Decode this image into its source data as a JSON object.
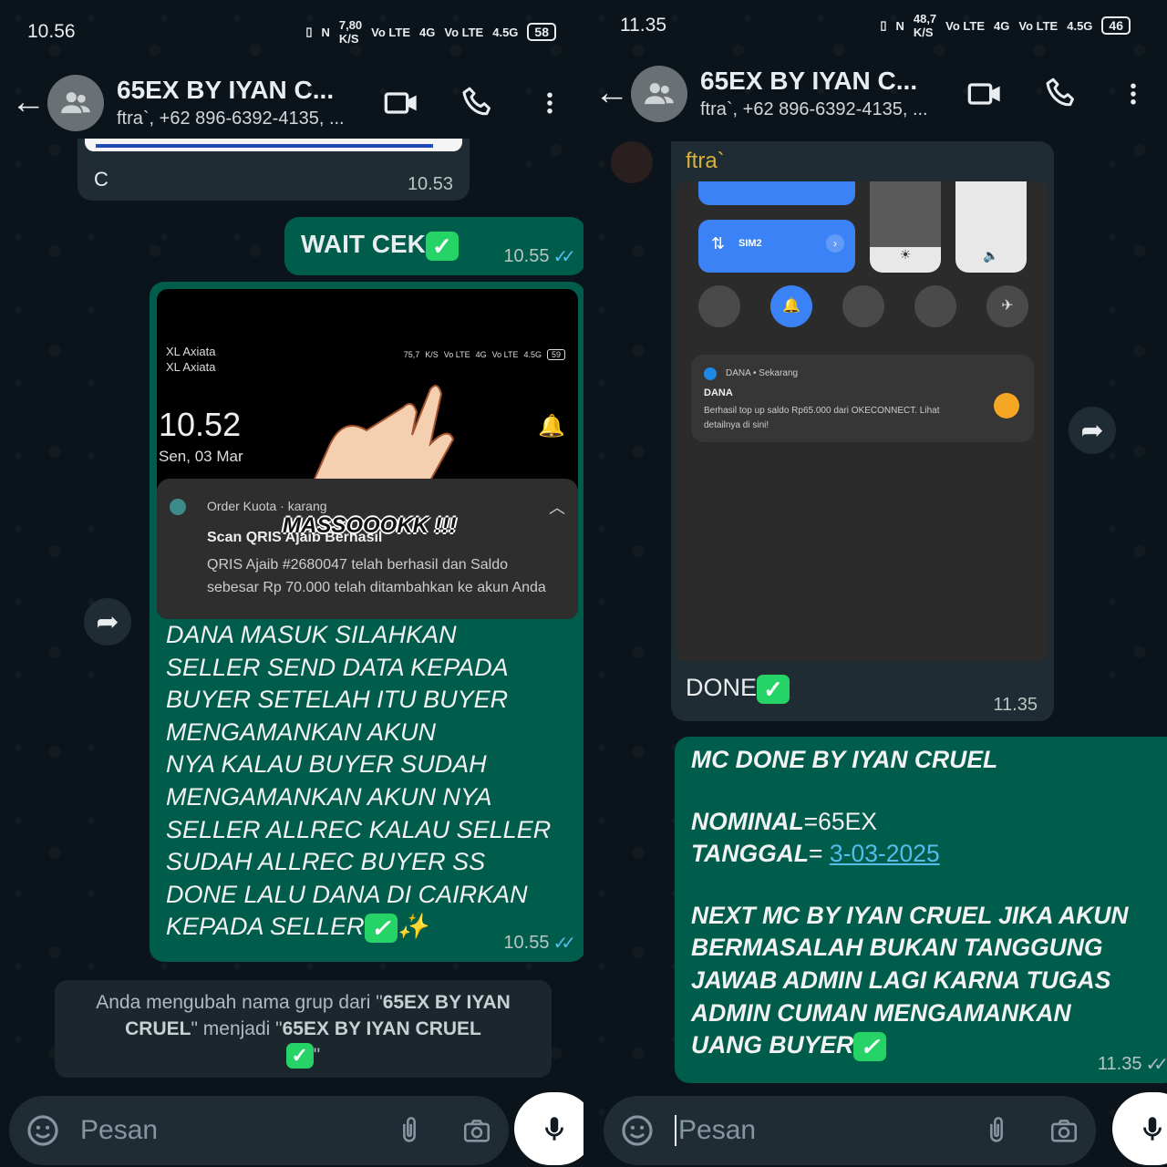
{
  "left": {
    "status": {
      "time": "10.56",
      "speed": "7,80",
      "speed_unit": "K/S",
      "vo1": "Vo LTE",
      "net1": "4G",
      "vo2": "Vo LTE",
      "net2": "4.5G",
      "battery": "58"
    },
    "header": {
      "title": "65EX BY IYAN C...",
      "subtitle": "ftra`, +62 896-6392-4135, ..."
    },
    "prev_bubble": {
      "text": "C",
      "time": "10.53"
    },
    "wait_bubble": {
      "text": "WAIT CEK",
      "time": "10.55"
    },
    "image_bubble": {
      "screenshot": {
        "carrier1": "XL Axiata",
        "carrier2": "XL Axiata",
        "speed": "75,7",
        "speed_unit": "K/S",
        "vo1": "Vo LTE",
        "net1": "4G",
        "vo2": "Vo LTE",
        "net2": "4.5G",
        "battery": "59",
        "clock": "10.52",
        "date": "Sen, 03 Mar",
        "notif_app": "Order Kuota",
        "notif_time": "karang",
        "notif_title": "Scan QRIS Ajaib Berhasil",
        "notif_body": "QRIS Ajaib #2680047 telah berhasil dan Saldo sebesar Rp 70.000 telah ditambahkan ke akun Anda",
        "sticker_text": "MASSOOOKK !!!"
      },
      "caption_lines": [
        "DANA MASUK SILAHKAN",
        "SELLER SEND DATA KEPADA",
        "BUYER SETELAH ITU BUYER",
        "MENGAMANKAN AKUN",
        "NYA KALAU BUYER SUDAH",
        "MENGAMANKAN AKUN NYA",
        "SELLER ALLREC KALAU SELLER",
        "SUDAH ALLREC BUYER SS",
        "DONE LALU DANA DI CAIRKAN",
        "KEPADA SELLER"
      ],
      "sparkle": "✨",
      "time": "10.55"
    },
    "system_msg": {
      "p1": "Anda mengubah nama grup dari \"",
      "old": "65EX BY IYAN CRUEL",
      "p2": "\" menjadi \"",
      "new": "65EX BY IYAN CRUEL",
      "p3": "\""
    },
    "input": {
      "placeholder": "Pesan"
    }
  },
  "right": {
    "status": {
      "time": "11.35",
      "speed": "48,7",
      "speed_unit": "K/S",
      "vo1": "Vo LTE",
      "net1": "4G",
      "vo2": "Vo LTE",
      "net2": "4.5G",
      "battery": "46"
    },
    "header": {
      "title": "65EX BY IYAN C...",
      "subtitle": "ftra`, +62 896-6392-4135, ..."
    },
    "in_bubble": {
      "sender": "ftra`",
      "screenshot": {
        "sim_label": "SIM2",
        "notif_header": "DANA • Sekarang",
        "notif_title": "DANA",
        "notif_body": "Berhasil top up saldo Rp65.000 dari OKECONNECT. Lihat detailnya di sini!"
      },
      "text": "DONE",
      "time": "11.35"
    },
    "out_bubble": {
      "title": "MC DONE BY IYAN CRUEL",
      "nominal_label": "NOMINAL",
      "nominal_value": "=65EX",
      "tanggal_label": "TANGGAL",
      "tanggal_eq": "= ",
      "tanggal_value": "3-03-2025",
      "note_lines": [
        "NEXT MC BY IYAN CRUEL JIKA AKUN",
        "BERMASALAH BUKAN TANGGUNG",
        "JAWAB ADMIN LAGI KARNA TUGAS",
        "ADMIN CUMAN MENGAMANKAN",
        "UANG BUYER"
      ],
      "time": "11.35"
    },
    "input": {
      "placeholder": "Pesan"
    }
  },
  "colors": {
    "bg": "#0b141a",
    "outgoing": "#005c4b",
    "incoming": "#202c33",
    "read_ticks": "#53bdeb",
    "check_green": "#25d366",
    "link": "#53bdeb",
    "sender_name": "#d9b23b"
  },
  "icons": [
    "back-arrow-icon",
    "group-avatar-icon",
    "video-call-icon",
    "voice-call-icon",
    "more-vert-icon",
    "emoji-icon",
    "attach-icon",
    "camera-icon",
    "mic-icon",
    "forward-icon",
    "check-mark-icon"
  ]
}
